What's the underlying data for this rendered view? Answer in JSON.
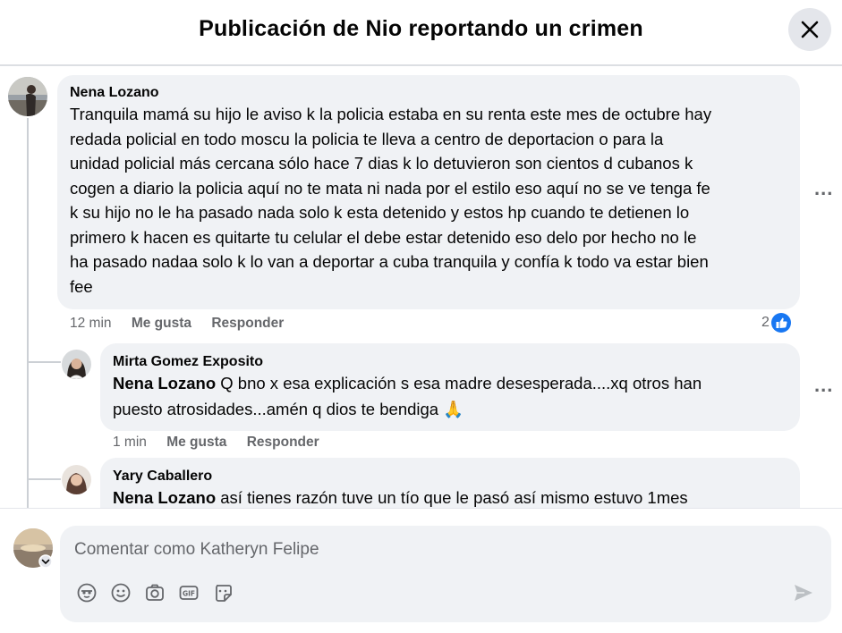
{
  "header": {
    "title": "Publicación de Nio reportando un crimen"
  },
  "icons": {
    "close": "close-icon",
    "more": "more-options-icon",
    "like": "like-reaction-icon",
    "send": "send-icon"
  },
  "comments": [
    {
      "author": "Nena Lozano",
      "lines": [
        "Tranquila mamá su hijo le aviso k la policia estaba en su renta este mes de octubre hay",
        "redada policial en todo moscu la policia te lleva a centro de deportacion o para la",
        "unidad policial más cercana sólo hace 7 dias k lo detuvieron son cientos d cubanos k",
        "cogen a diario la policia aquí no te mata ni nada por el estilo eso aquí no se ve tenga fe",
        "k su hijo no le ha pasado nada solo k esta detenido y estos hp cuando te detienen lo",
        "primero k hacen es quitarte tu celular el debe estar detenido eso delo por hecho no le",
        "ha pasado nadaa solo k lo van a deportar a cuba tranquila y confía k todo va estar bien",
        "fee"
      ],
      "time": "12 min",
      "like_label": "Me gusta",
      "reply_label": "Responder",
      "reaction_count": "2",
      "more": "..."
    }
  ],
  "replies": [
    {
      "author": "Mirta Gomez Exposito",
      "mention": "Nena Lozano",
      "line1": " Q bno x esa explicación s esa madre desesperada....xq otros han",
      "line2": "puesto atrosidades...amén q dios te bendiga",
      "emoji": "🙏",
      "time": "1 min",
      "like_label": "Me gusta",
      "reply_label": "Responder",
      "more": "..."
    },
    {
      "author": "Yary Caballero",
      "mention": "Nena Lozano",
      "line1": " así tienes razón tuve un tío que le pasó así mismo estuvo 1mes"
    }
  ],
  "composer": {
    "placeholder": "Comentar como Katheryn Felipe",
    "tools": [
      "avatar-sticker-icon",
      "emoji-icon",
      "camera-icon",
      "gif-icon",
      "sticker-icon"
    ]
  }
}
